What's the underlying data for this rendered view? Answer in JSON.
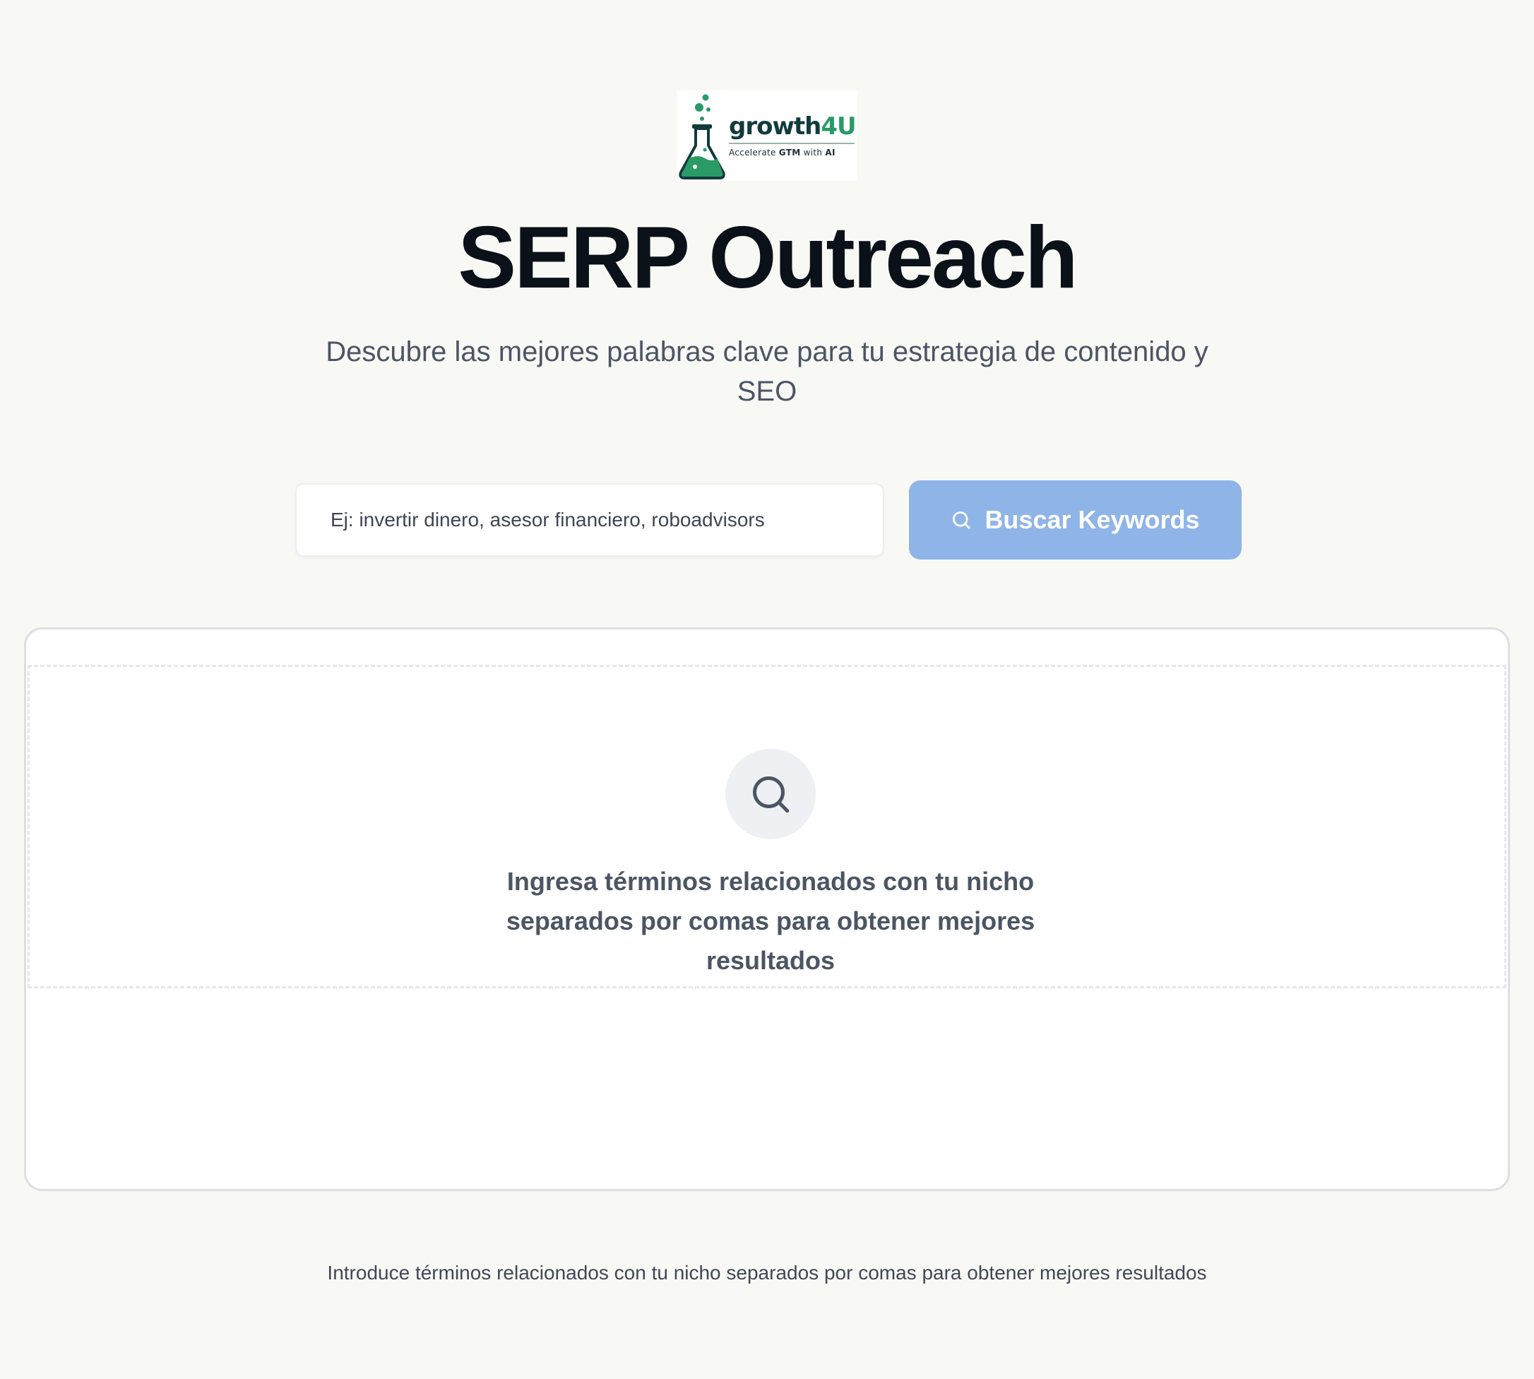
{
  "logo": {
    "brand_main": "growth",
    "brand_accent": "4U",
    "tagline_prefix": "Accelerate ",
    "tagline_bold1": "GTM",
    "tagline_mid": " with ",
    "tagline_bold2": "AI",
    "icon": "flask-icon",
    "brand_colors": {
      "dark": "#123b3c",
      "accent": "#2a9a67"
    }
  },
  "header": {
    "title": "SERP Outreach",
    "subtitle": "Descubre las mejores palabras clave para tu estrategia de contenido y SEO"
  },
  "search": {
    "value": "",
    "placeholder": "Ej: invertir dinero, asesor financiero, roboadvisors",
    "button_label": "Buscar Keywords",
    "button_icon": "search-icon",
    "button_color": "#8fb4e7"
  },
  "results": {
    "empty_icon": "search-icon",
    "empty_message": "Ingresa términos relacionados con tu nicho separados por comas para obtener mejores resultados"
  },
  "footer": {
    "hint": "Introduce términos relacionados con tu nicho separados por comas para obtener mejores resultados"
  }
}
